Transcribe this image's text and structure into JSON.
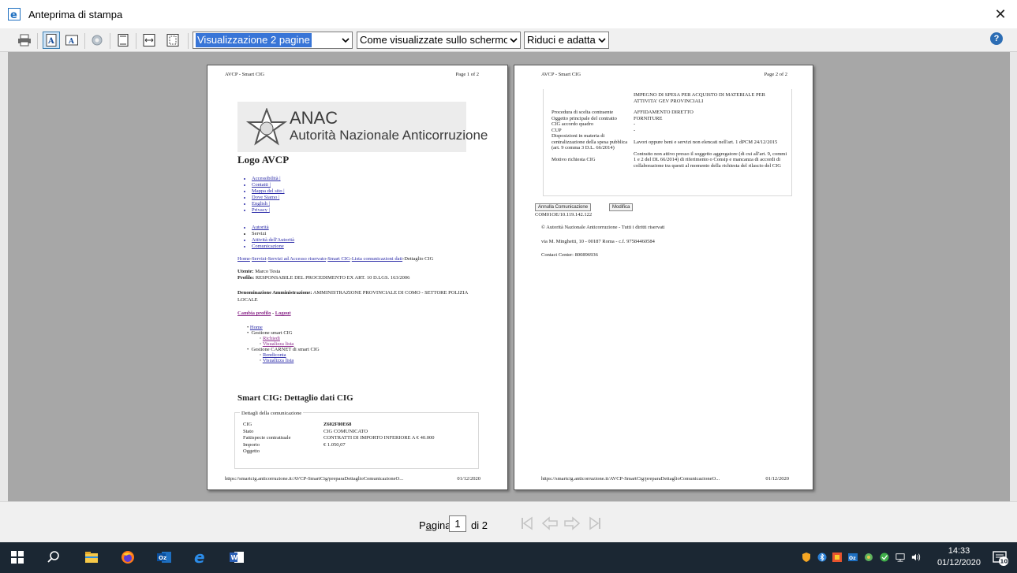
{
  "window": {
    "title": "Anteprima di stampa"
  },
  "toolbar": {
    "view_mode": "Visualizzazione 2 pagine",
    "print_setting": "Come visualizzate sullo schermo",
    "scale": "Riduci e adatta"
  },
  "page1": {
    "header_left": "AVCP - Smart CIG",
    "header_right": "Page 1 of 2",
    "anac_logo": "ANAC",
    "anac_name": "Autorità Nazionale Anticorruzione",
    "logo_title": "Logo AVCP",
    "links1": [
      "Accessibilità |",
      "Contatti |",
      "Mappa del sito |",
      "Dove Siamo |",
      "English |",
      "Privacy |"
    ],
    "links2": [
      "Autorità",
      "Servizi",
      "Attività dell'Autorità",
      "Comunicazione"
    ],
    "breadcrumb": {
      "home": "Home",
      "servizi": "Servizi",
      "accesso": "Servizi ad Accesso riservato",
      "smartcig": "Smart CIG",
      "lista": "Lista comunicazioni dati",
      "current": "Dettaglio CIG"
    },
    "user_label": "Utente:",
    "user_value": "Marco Testa",
    "profile_label": "Profilo:",
    "profile_value": "RESPONSABILE DEL PROCEDIMENTO EX ART. 10 D.LGS. 163/2006",
    "denom_label": "Denominazione Amministrazione:",
    "denom_value": "AMMINISTRAZIONE PROVINCIALE DI COMO - SETTORE POLIZIA LOCALE",
    "change_profile": "Cambia profilo",
    "dash": "-",
    "logout": "Logout",
    "menu": {
      "home": "Home",
      "gestione_smart": "Gestione smart CIG",
      "richiedi": "Richiedi",
      "visualizza1": "Visualizza lista",
      "gestione_carnet": "Gestione CARNET di smart CIG",
      "rendiconta": "Rendiconta",
      "visualizza2": "Visualizza lista"
    },
    "section_title": "Smart CIG: Dettaglio dati CIG",
    "box_legend": "Dettagli della comunicazione",
    "rows": [
      {
        "k": "CIG",
        "v": "Z602F80E68"
      },
      {
        "k": "Stato",
        "v": "CIG COMUNICATO"
      },
      {
        "k": "Fattispecie contrattuale",
        "v": "CONTRATTI DI IMPORTO INFERIORE A € 40.000"
      },
      {
        "k": "Importo",
        "v": "€ 1.050,07"
      },
      {
        "k": "Oggetto",
        "v": ""
      }
    ],
    "footer_url": "https://smartcig.anticorruzione.it/AVCP-SmartCig/preparaDettaglioComunicazioneO...",
    "footer_date": "01/12/2020"
  },
  "page2": {
    "header_left": "AVCP - Smart CIG",
    "header_right": "Page 2 of 2",
    "oggetto_value": "IMPEGNO DI SPESA PER ACQUISTO DI MATERIALE PER ATTIVITA' GEV PROVINCIALI",
    "rows": [
      {
        "k": "Procedura di scelta contraente",
        "v": "AFFIDAMENTO DIRETTO"
      },
      {
        "k": "Oggetto principale del contratto",
        "v": "FORNITURE"
      },
      {
        "k": "CIG accordo quadro",
        "v": "-"
      },
      {
        "k": "CUP",
        "v": "-"
      },
      {
        "k": "Disposizioni in materia di centralizzazione della spesa pubblica (art. 9 comma 3 D.L. 66/2014)",
        "v": "Lavori oppure beni e servizi non elencati nell'art. 1 dPCM 24/12/2015"
      },
      {
        "k": "Motivo richiesta CIG",
        "v": "Contratto non attivo presso il soggetto aggregatore (di cui all'art. 9, commi 1 e 2 del DL 66/2014) di riferimento o Consip e mancanza di accordi di collaborazione tra questi al momento della richiesta del rilascio del CIG"
      }
    ],
    "btn_annulla": "Annulla Comunicazione",
    "btn_modifica": "Modifica",
    "server": "COM01OE/10.119.142.122",
    "copyright": "© Autorità Nazionale Anticorruzione - Tutti i diritti riservati",
    "address": "via M. Minghetti, 10 - 00187 Roma - c.f. 97584460584",
    "contact": "Contact Center: 800896936",
    "footer_url": "https://smartcig.anticorruzione.it/AVCP-SmartCig/preparaDettaglioComunicazioneO...",
    "footer_date": "01/12/2020"
  },
  "status": {
    "page_label_pre": "P",
    "page_label_u": "a",
    "page_label_post": "gina",
    "page_value": "1",
    "page_of": "di 2"
  },
  "taskbar": {
    "time": "14:33",
    "date": "01/12/2020",
    "notif_count": "10"
  }
}
